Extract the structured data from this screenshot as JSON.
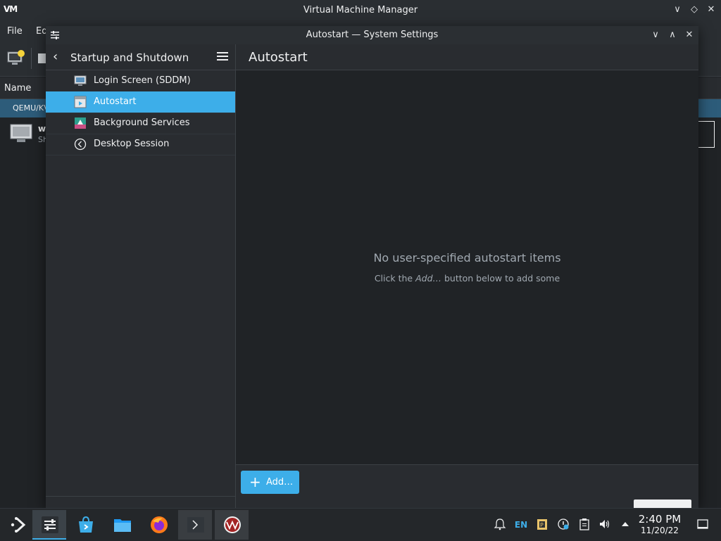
{
  "background_window": {
    "title": "Virtual Machine Manager",
    "logo": "VM",
    "menu": [
      "File",
      "Ed"
    ],
    "column_header": "Name",
    "group_label": "QEMU/KV",
    "vm_item_initial": "w",
    "vm_item_sub": "Sh",
    "controls": {
      "minimize": "∨",
      "maximize": "◇",
      "close": "✕"
    }
  },
  "window": {
    "title": "Autostart — System Settings",
    "controls": {
      "minimize": "∨",
      "maximize": "∧",
      "close": "✕"
    }
  },
  "sidebar": {
    "back_glyph": "‹",
    "title": "Startup and Shutdown",
    "items": [
      {
        "label": "Login Screen (SDDM)",
        "icon": "monitor-icon",
        "active": false
      },
      {
        "label": "Autostart",
        "icon": "autostart-icon",
        "active": true
      },
      {
        "label": "Background Services",
        "icon": "services-icon",
        "active": false
      },
      {
        "label": "Desktop Session",
        "icon": "session-icon",
        "active": false
      }
    ]
  },
  "main": {
    "title": "Autostart",
    "empty_title": "No user-specified autostart items",
    "empty_sub_pre": "Click the ",
    "empty_sub_em": "Add…",
    "empty_sub_post": " button below to add some",
    "add_plus": "+",
    "add_button": "Add…"
  },
  "taskbar": {
    "apps": [
      "application-launcher-icon",
      "system-settings-icon",
      "discover-icon",
      "dolphin-icon",
      "firefox-icon",
      "konsole-icon",
      "virt-manager-icon"
    ],
    "tray": {
      "language": "EN",
      "notifications_icon": "bell-icon",
      "clipboard_icon": "clipboard-icon",
      "volume_icon": "speaker-icon"
    },
    "clock": {
      "time": "2:40 PM",
      "date": "11/20/22"
    }
  },
  "colors": {
    "accent": "#3daee9",
    "window_bg": "#202326",
    "sidebar_bg": "#292c30",
    "text": "#eff0f1",
    "muted_text": "#a1a9b1"
  }
}
